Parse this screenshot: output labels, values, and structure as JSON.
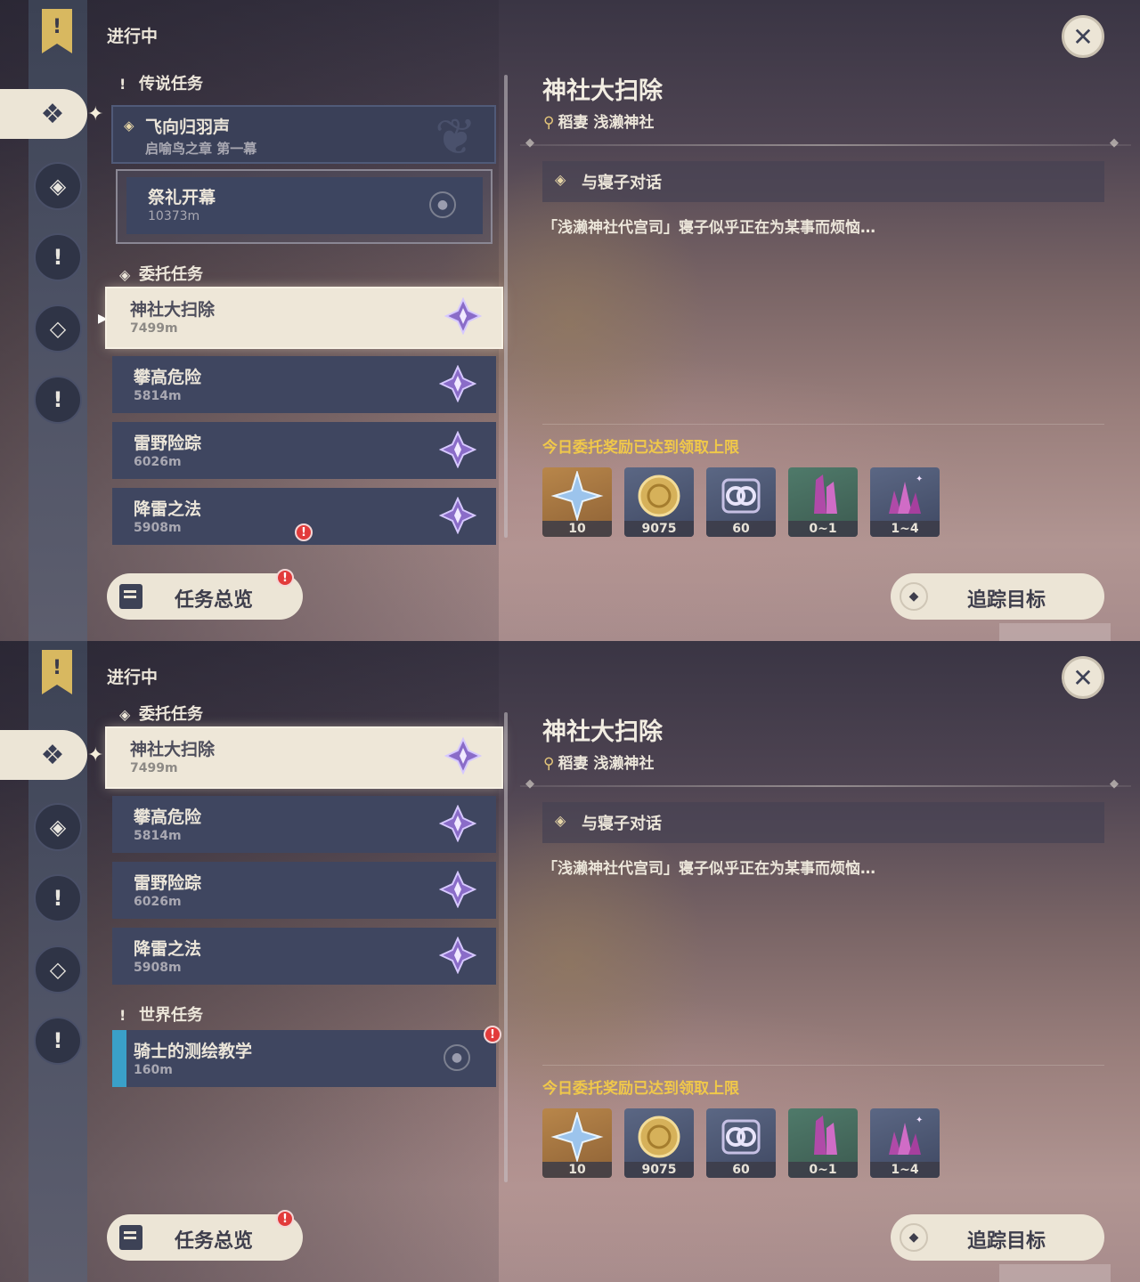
{
  "screens": [
    {
      "status_title": "进行中",
      "legend_header": "传说任务",
      "legend_quest": {
        "title": "飞向归羽声",
        "subtitle": "启喻鸟之章 第一幕"
      },
      "legend_step": {
        "title": "祭礼开幕",
        "distance": "10373m"
      },
      "commission_header": "委托任务",
      "commissions": [
        {
          "title": "神社大扫除",
          "distance": "7499m"
        },
        {
          "title": "攀高危险",
          "distance": "5814m"
        },
        {
          "title": "雷野险踪",
          "distance": "6026m"
        },
        {
          "title": "降雷之法",
          "distance": "5908m"
        }
      ],
      "world_header": "",
      "world_task": {
        "title": "",
        "distance": ""
      }
    },
    {
      "status_title": "进行中",
      "commission_header": "委托任务",
      "commissions": [
        {
          "title": "神社大扫除",
          "distance": "7499m"
        },
        {
          "title": "攀高危险",
          "distance": "5814m"
        },
        {
          "title": "雷野险踪",
          "distance": "6026m"
        },
        {
          "title": "降雷之法",
          "distance": "5908m"
        }
      ],
      "world_header": "世界任务",
      "world_task": {
        "title": "骑士的测绘教学",
        "distance": "160m"
      }
    }
  ],
  "detail": {
    "title": "神社大扫除",
    "location": "稻妻 浅濑神社",
    "objective": "与寝子对话",
    "description": "「浅濑神社代宫司」寝子似乎正在为某事而烦恼…",
    "reward_note": "今日委托奖励已达到领取上限",
    "rewards": [
      {
        "name": "primogem-icon",
        "count": "10"
      },
      {
        "name": "mora-icon",
        "count": "9075"
      },
      {
        "name": "adventure-exp-icon",
        "count": "60"
      },
      {
        "name": "enhancement-ore-icon",
        "count": "0~1"
      },
      {
        "name": "crystal-chunk-icon",
        "count": "1~4"
      }
    ]
  },
  "buttons": {
    "overview": "任务总览",
    "track": "追踪目标",
    "close": "✕"
  },
  "badge": "!",
  "colors": {
    "accent_gold": "#f0c84a",
    "selected_bg": "#eee7d8",
    "card_bg": "#3f4660",
    "world_bar": "#3aa0c8",
    "alert_red": "#e23b3b"
  }
}
